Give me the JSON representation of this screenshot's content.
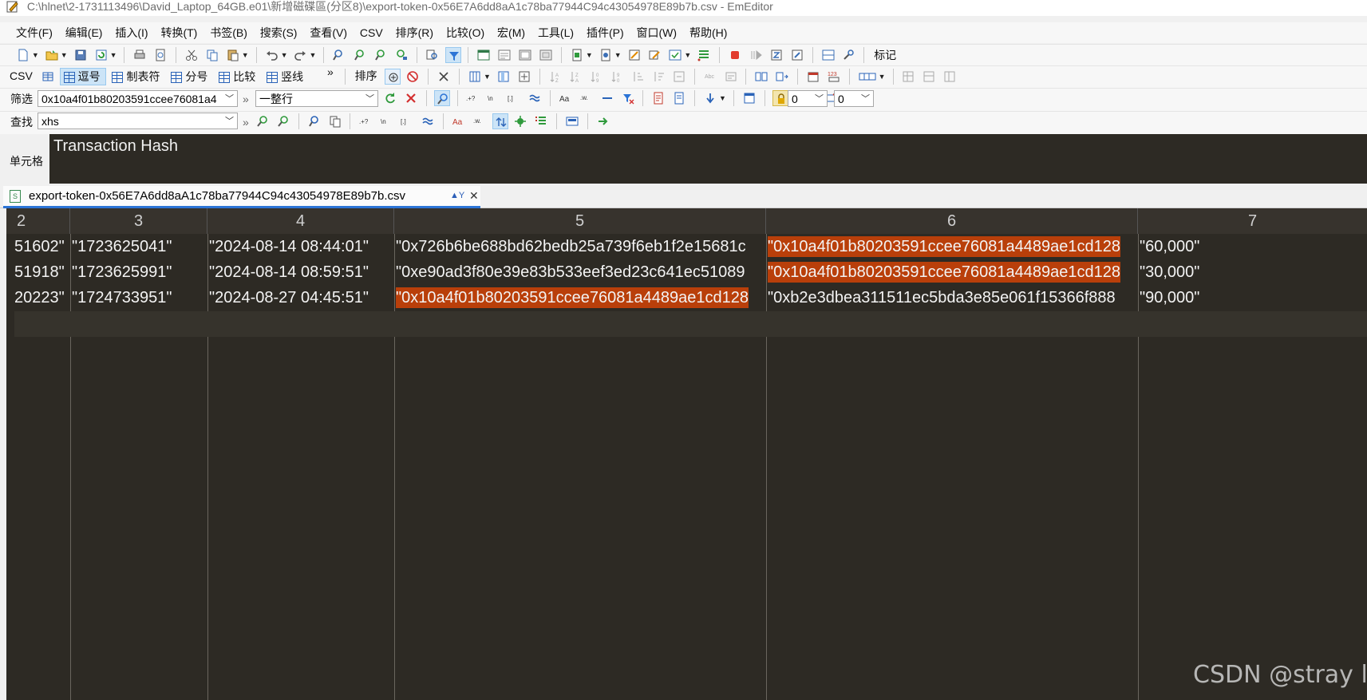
{
  "window": {
    "title": "C:\\hlnet\\2-1731113496\\David_Laptop_64GB.e01\\新增磁碟區(分区8)\\export-token-0x56E7A6dd8aA1c78ba77944C94c43054978E89b7b.csv - EmEditor"
  },
  "menu": [
    "文件(F)",
    "编辑(E)",
    "插入(I)",
    "转换(T)",
    "书签(B)",
    "搜索(S)",
    "查看(V)",
    "CSV",
    "排序(R)",
    "比较(O)",
    "宏(M)",
    "工具(L)",
    "插件(P)",
    "窗口(W)",
    "帮助(H)"
  ],
  "toolbar1": {
    "mark_label": "标记"
  },
  "csvbar": {
    "csv_label": "CSV",
    "buttons": [
      "逗号",
      "制表符",
      "分号",
      "比较",
      "竖线"
    ],
    "sort_label": "排序",
    "more": "»"
  },
  "filter": {
    "label": "筛选",
    "value": "0x10a4f01b80203591ccee76081a4",
    "scope": "一整行",
    "num1": "0",
    "num2": "0",
    "more": "»"
  },
  "find": {
    "label": "查找",
    "value": "xhs",
    "more": "»"
  },
  "cellbar": {
    "label": "单元格",
    "value": "Transaction Hash"
  },
  "tab": {
    "filename": "export-token-0x56E7A6dd8aA1c78ba77944C94c43054978E89b7b.csv"
  },
  "grid": {
    "headers": [
      "2",
      "3",
      "4",
      "5",
      "6",
      "7"
    ],
    "rows": [
      [
        "51602\"",
        "\"1723625041\"",
        "\"2024-08-14 08:44:01\"",
        "\"0x726b6be688bd62bedb25a739f6eb1f2e15681c",
        "\"0x10a4f01b80203591ccee76081a4489ae1cd128",
        "\"60,000\""
      ],
      [
        "51918\"",
        "\"1723625991\"",
        "\"2024-08-14 08:59:51\"",
        "\"0xe90ad3f80e39e83b533eef3ed23c641ec51089",
        "\"0x10a4f01b80203591ccee76081a4489ae1cd128",
        "\"30,000\""
      ],
      [
        "20223\"",
        "\"1724733951\"",
        "\"2024-08-27 04:45:51\"",
        "\"0x10a4f01b80203591ccee76081a4489ae1cd128",
        "\"0xb2e3dbea311511ec5bda3e85e061f15366f888",
        "\"90,000\""
      ]
    ]
  },
  "watermark": "CSDN @stray l",
  "colors": {
    "grid_bg": "#2d2a24",
    "highlight": "#b93f0a",
    "tab_accent": "#2c74d6"
  }
}
